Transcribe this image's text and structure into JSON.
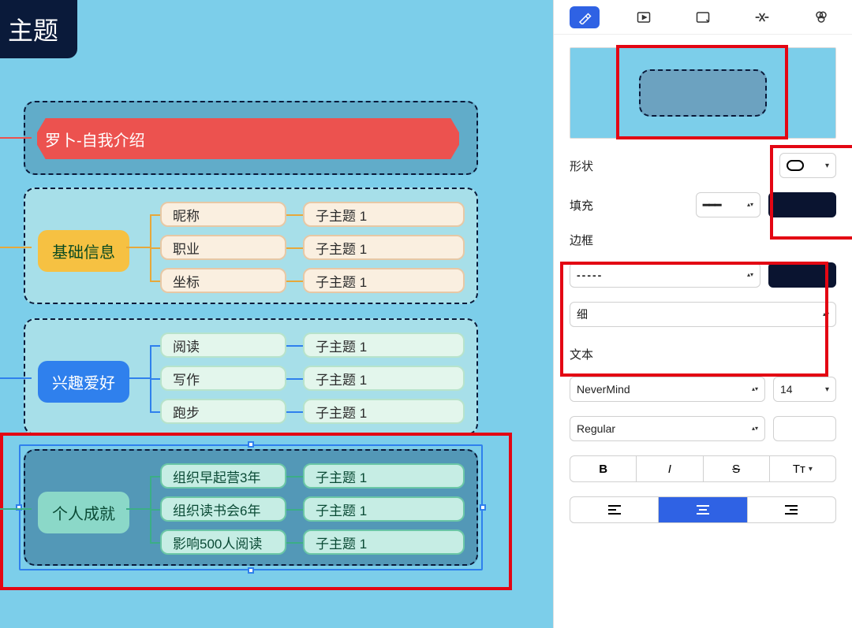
{
  "canvas": {
    "root_title_fragment": "主题",
    "banner": "罗卜-自我介绍",
    "group1": {
      "main": "基础信息",
      "children": [
        {
          "label": "昵称",
          "sub": "子主题 1"
        },
        {
          "label": "职业",
          "sub": "子主题 1"
        },
        {
          "label": "坐标",
          "sub": "子主题 1"
        }
      ]
    },
    "group2": {
      "main": "兴趣爱好",
      "children": [
        {
          "label": "阅读",
          "sub": "子主题 1"
        },
        {
          "label": "写作",
          "sub": "子主题 1"
        },
        {
          "label": "跑步",
          "sub": "子主题 1"
        }
      ]
    },
    "group3": {
      "main": "个人成就",
      "children": [
        {
          "label": "组织早起营3年",
          "sub": "子主题 1"
        },
        {
          "label": "组织读书会6年",
          "sub": "子主题 1"
        },
        {
          "label": "影响500人阅读",
          "sub": "子主题 1"
        }
      ]
    }
  },
  "panel": {
    "tabs": [
      "format",
      "media",
      "note",
      "relationship",
      "style"
    ],
    "shape_label": "形状",
    "fill_label": "填充",
    "fill_value_bar": "━━━",
    "border_label": "边框",
    "border_style": "-----",
    "border_width": "细",
    "text_label": "文本",
    "font_family": "NeverMind",
    "font_size": "14",
    "font_weight": "Regular",
    "bold": "B",
    "italic": "I",
    "strike": "S",
    "textcase": "Tᴛ"
  }
}
